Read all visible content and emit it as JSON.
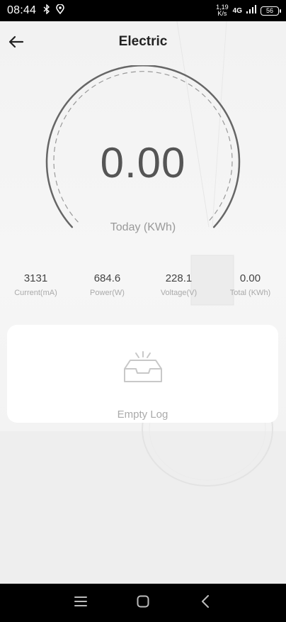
{
  "status_bar": {
    "time": "08:44",
    "net_speed_value": "1,19",
    "net_speed_unit": "K/s",
    "network_type": "4G",
    "battery": "56"
  },
  "header": {
    "title": "Electric"
  },
  "gauge": {
    "value": "0.00",
    "label": "Today (KWh)"
  },
  "stats": [
    {
      "value": "3131",
      "label": "Current(mA)"
    },
    {
      "value": "684.6",
      "label": "Power(W)"
    },
    {
      "value": "228.1",
      "label": "Voltage(V)"
    },
    {
      "value": "0.00",
      "label": "Total (KWh)"
    }
  ],
  "log": {
    "empty_text": "Empty Log"
  },
  "colors": {
    "gauge_stroke": "#666666",
    "status_bar_bg": "#000000",
    "card_bg": "#ffffff"
  },
  "icons": {
    "back": "arrow-left-icon",
    "empty_log": "empty-tray-icon",
    "nav_menu": "menu-icon",
    "nav_home": "home-icon",
    "nav_back": "chevron-left-icon"
  }
}
